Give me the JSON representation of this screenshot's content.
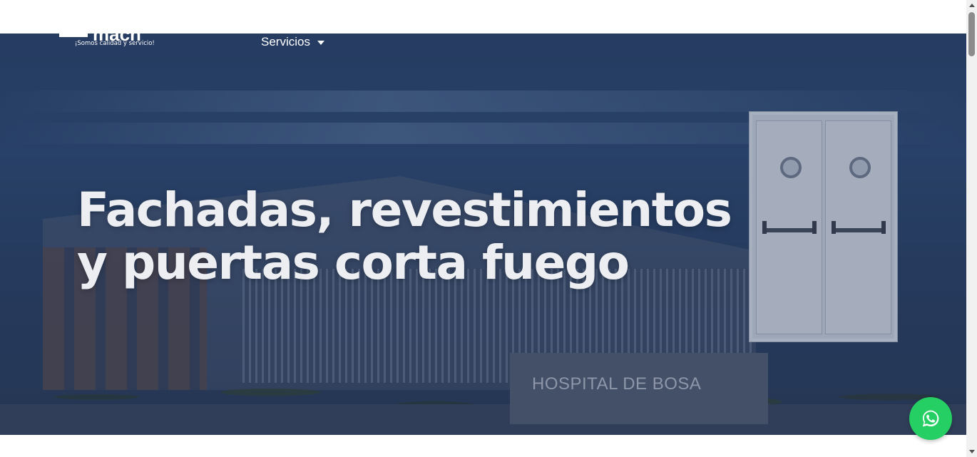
{
  "header": {
    "logo_word": "macn",
    "logo_tagline": "¡Somos calidad y servicio!",
    "nav": {
      "servicios_label": "Servicios"
    }
  },
  "hero": {
    "title_line1": "Fachadas, revestimientos",
    "title_line2": "y puertas corta fuego",
    "sign_text": "HOSPITAL DE BOSA"
  },
  "floating": {
    "whatsapp_icon": "whatsapp-icon"
  },
  "colors": {
    "whatsapp_green": "#26cf63",
    "hero_overlay": "#2c4468"
  }
}
